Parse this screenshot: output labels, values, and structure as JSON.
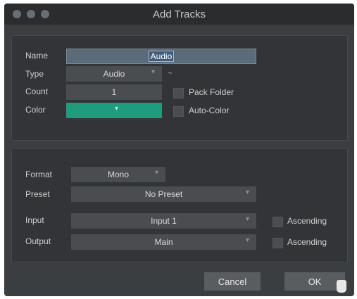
{
  "window": {
    "title": "Add Tracks"
  },
  "labels": {
    "name": "Name",
    "type": "Type",
    "count": "Count",
    "color": "Color",
    "format": "Format",
    "preset": "Preset",
    "input": "Input",
    "output": "Output"
  },
  "fields": {
    "name_value": "Audio",
    "type_value": "Audio",
    "count_value": "1",
    "color_value": "#1f9b7e",
    "format_value": "Mono",
    "preset_value": "No Preset",
    "input_value": "Input 1",
    "output_value": "Main"
  },
  "checkboxes": {
    "pack_folder": "Pack Folder",
    "auto_color": "Auto-Color",
    "input_ascending": "Ascending",
    "output_ascending": "Ascending"
  },
  "buttons": {
    "cancel": "Cancel",
    "ok": "OK"
  },
  "icons": {
    "chevron": "chevron-down-icon",
    "type_extra": "monitor-wave-icon",
    "cursor": "hand-pointer-icon"
  }
}
